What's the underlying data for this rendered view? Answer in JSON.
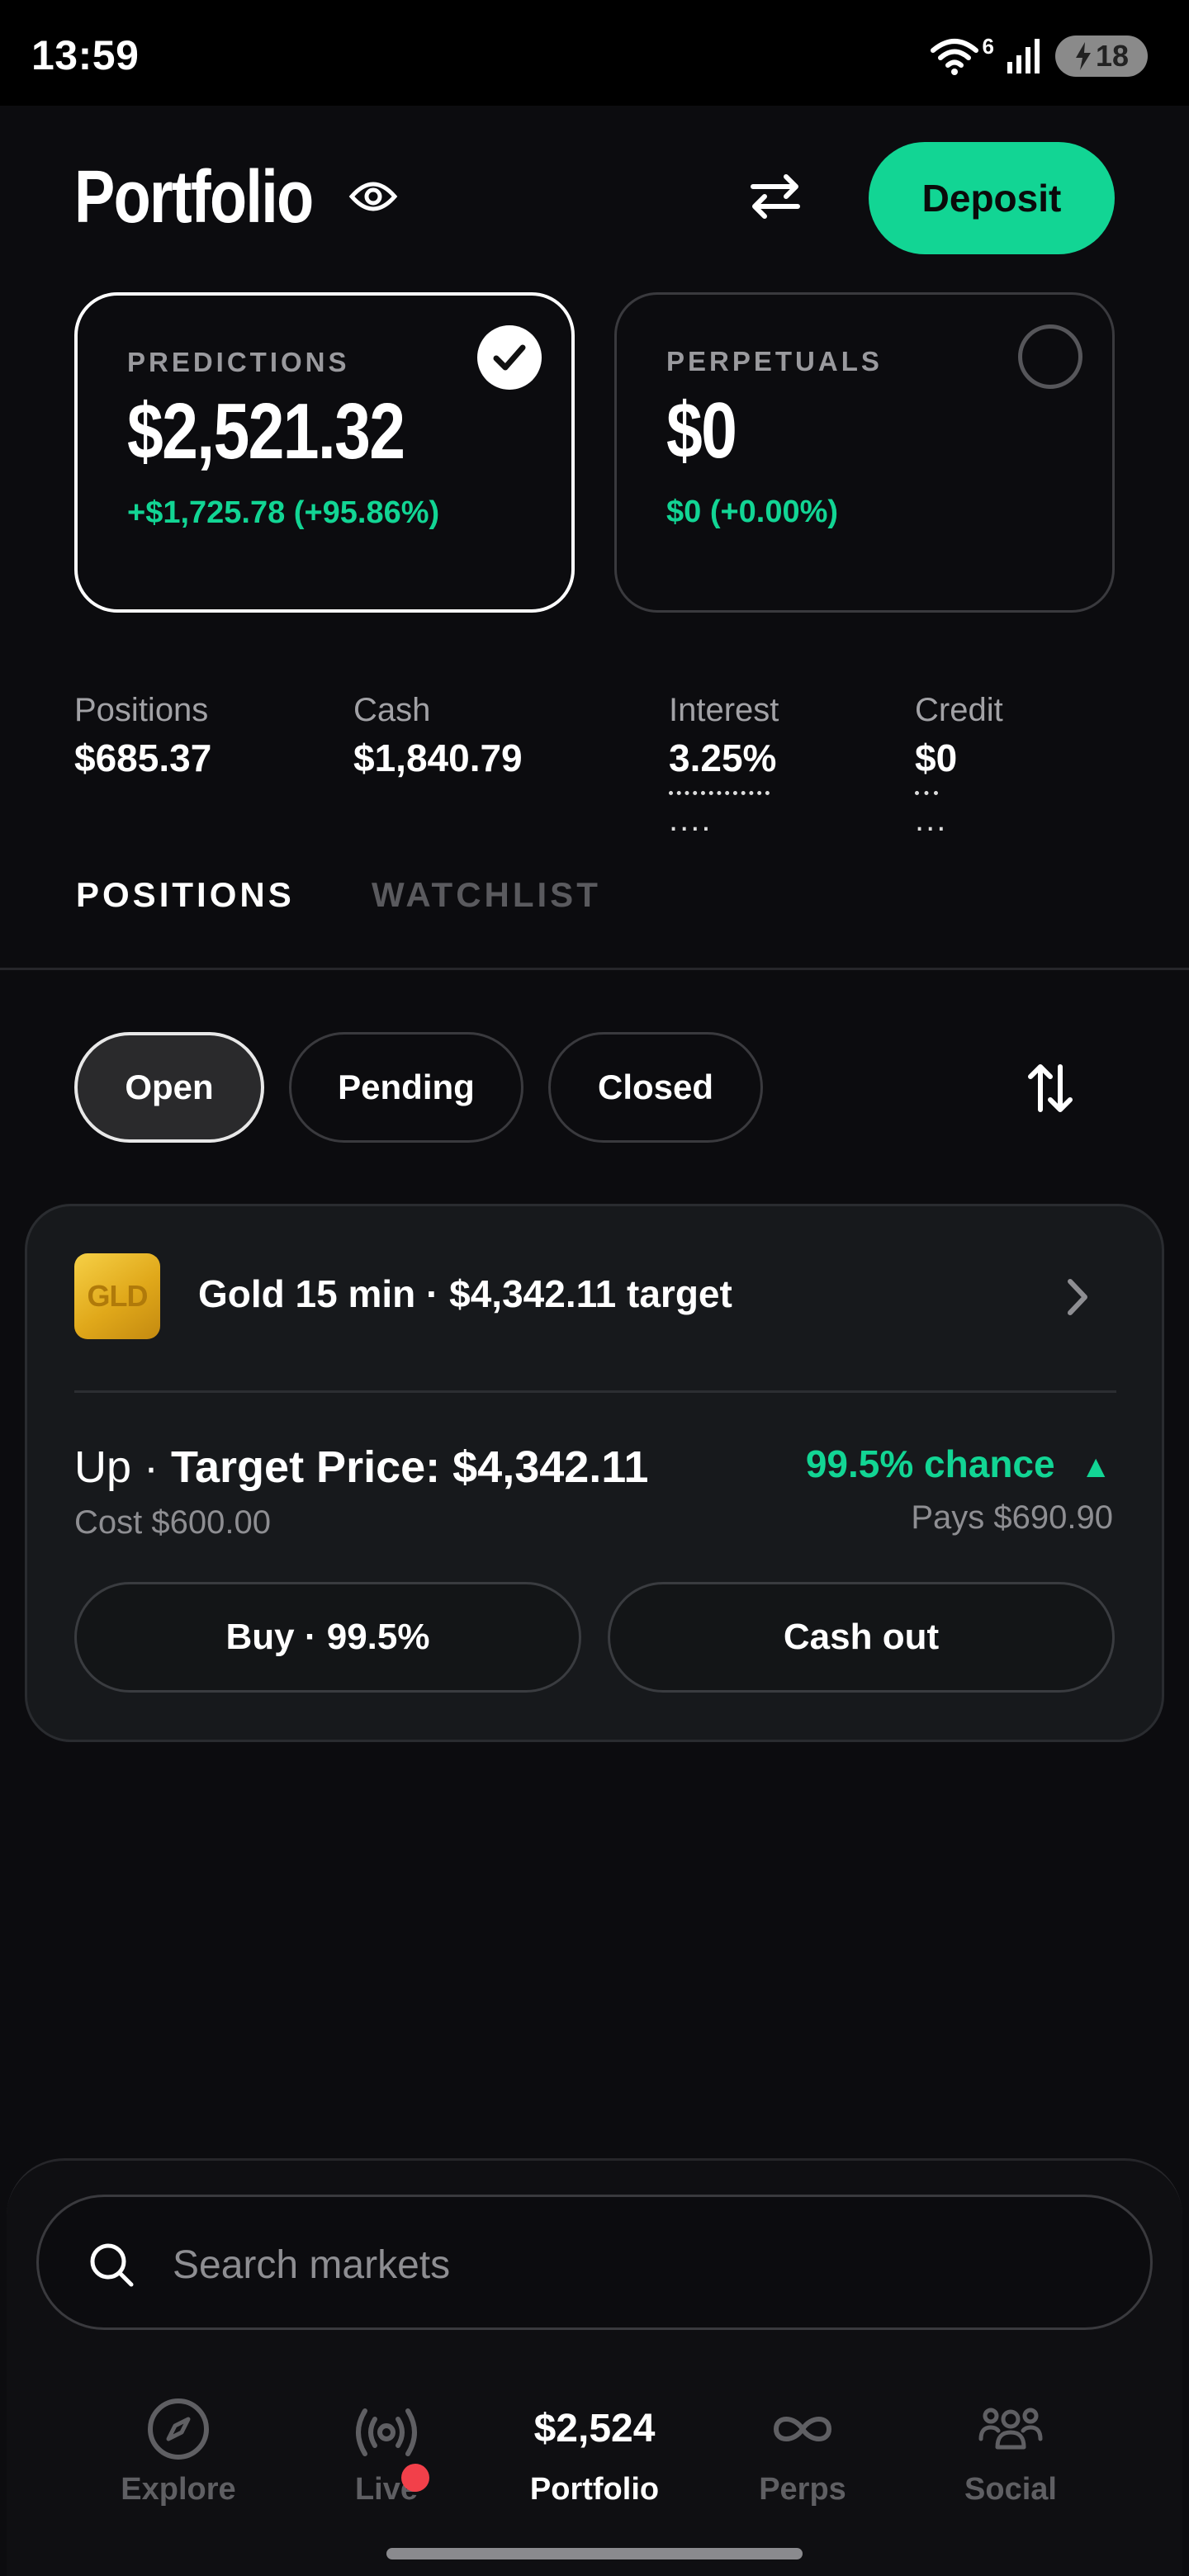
{
  "status_bar": {
    "time": "13:59",
    "battery": "18",
    "wifi_badge": "6"
  },
  "header": {
    "title": "Portfolio",
    "deposit_label": "Deposit"
  },
  "cards": [
    {
      "label": "PREDICTIONS",
      "value": "$2,521.32",
      "change": "+$1,725.78 (+95.86%)",
      "selected": true
    },
    {
      "label": "PERPETUALS",
      "value": "$0",
      "change": "$0 (+0.00%)",
      "selected": false
    }
  ],
  "stats": {
    "positions": {
      "label": "Positions",
      "value": "$685.37"
    },
    "cash": {
      "label": "Cash",
      "value": "$1,840.79"
    },
    "interest": {
      "label": "Interest",
      "value": "3.25%",
      "extra": "...."
    },
    "credit": {
      "label": "Credit",
      "value": "$0",
      "extra": "..."
    }
  },
  "tabs": {
    "positions": "POSITIONS",
    "watchlist": "WATCHLIST"
  },
  "filters": {
    "open": "Open",
    "pending": "Pending",
    "closed": "Closed"
  },
  "position": {
    "logo_text": "GLD",
    "title": "Gold 15 min · $4,342.11 target",
    "side": "Up · ",
    "target": "Target Price: $4,342.11",
    "cost": "Cost $600.00",
    "chance": "99.5% chance",
    "chance_arrow": "▲",
    "pays": "Pays $690.90",
    "buy_label": "Buy · 99.5%",
    "cashout_label": "Cash out"
  },
  "search": {
    "placeholder": "Search markets"
  },
  "nav": {
    "explore": "Explore",
    "live": "Live",
    "portfolio_value": "$2,524",
    "portfolio": "Portfolio",
    "perps": "Perps",
    "social": "Social"
  },
  "colors": {
    "accent": "#12d594",
    "background": "#0c0c0f",
    "live_dot": "#f2404a"
  }
}
